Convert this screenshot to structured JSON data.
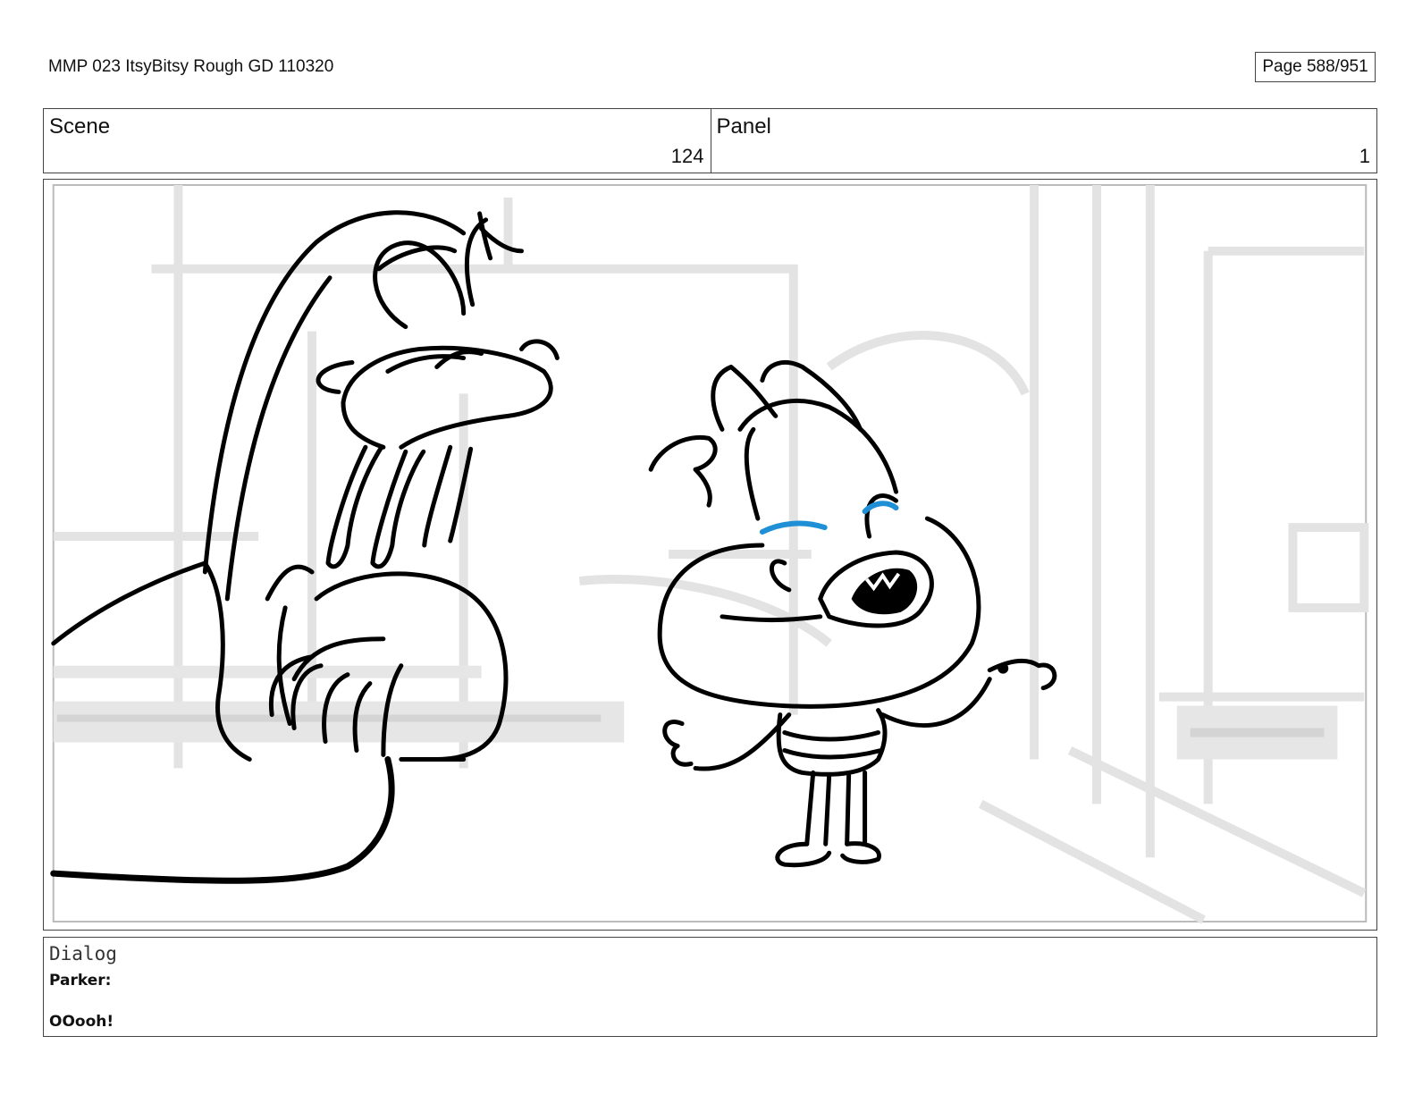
{
  "document": {
    "title": "MMP 023 ItsyBitsy Rough GD 110320",
    "page": "Page 588/951"
  },
  "header": {
    "scene_label": "Scene",
    "scene_value": "124",
    "panel_label": "Panel",
    "panel_value": "1"
  },
  "panel": {
    "image": "storyboard-sketch",
    "accent_color": "#1f8fd6"
  },
  "dialog": {
    "heading": "Dialog",
    "speaker": "Parker:",
    "line": "OOooh!"
  }
}
